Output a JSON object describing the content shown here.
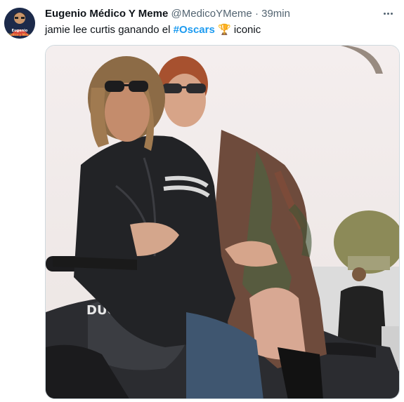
{
  "tweet": {
    "display_name": "Eugenio Médico Y Meme",
    "handle": "@MedicoYMeme",
    "separator": "·",
    "time": "39min",
    "text_before": "jamie lee curtis ganando el ",
    "hashtag": "#Oscars",
    "emoji": "🏆",
    "text_after": " iconic",
    "avatar_caption_line1": "Eugenio",
    "avatar_caption_line2": "Médico y Meme",
    "media_logo_text": "DUCATI",
    "icons": [
      "more-icon",
      "avatar-image",
      "trophy-emoji"
    ]
  }
}
